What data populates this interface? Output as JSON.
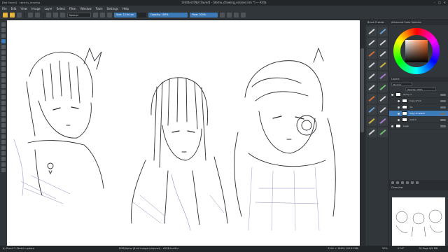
{
  "window": {
    "tabs": [
      "[Not Saved]",
      "sketchy_drawing"
    ],
    "title": "Untitled [Not Saved] - [demo_drawing_session.kra *] — Krita",
    "controls": [
      "–",
      "□",
      "✕"
    ]
  },
  "menu": [
    "File",
    "Edit",
    "View",
    "Image",
    "Layer",
    "Select",
    "Filter",
    "Window",
    "Tools",
    "Settings",
    "Help"
  ],
  "toolbar": {
    "blend_mode": "Normal",
    "size_label": "Size: 12.00 px",
    "opacity_label": "Opacity: 100%",
    "flow_label": "Flow: 100%"
  },
  "brush_panel": {
    "title": "Brush Presets"
  },
  "color_panel": {
    "title": "Advanced Color Selector"
  },
  "layers_panel": {
    "title": "Layers",
    "blend": "Normal",
    "opacity": "Opacity: 100%",
    "rows": [
      "Group 1",
      "Copy of ink",
      "ink",
      "Copy of sketch",
      "sketch",
      "Layer"
    ]
  },
  "overview_panel": {
    "title": "Overview"
  },
  "status": {
    "left": "b) Pencil-2 Sketch update",
    "center": "RGB/Alpha (8-bit integer/channel) - sRGB-built-in",
    "right_size": "3340 × 1869 (149.6 MiB)",
    "zoom": "50%",
    "rotation": "0.00°",
    "mem": "78 Page 6/4 MB"
  },
  "colors": {
    "accent": "#3d7ab8",
    "highlight": "#e6b33a",
    "panel": "#31363b",
    "dark": "#232629"
  }
}
